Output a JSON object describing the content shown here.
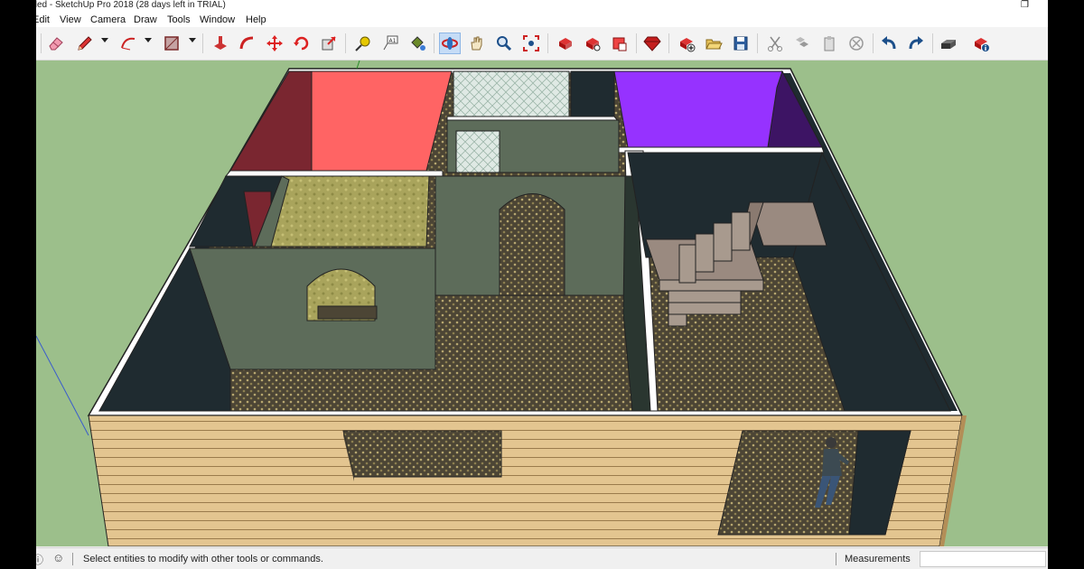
{
  "window": {
    "title": "tled - SketchUp Pro 2018 (28 days left in TRIAL)"
  },
  "menu": [
    "Edit",
    "View",
    "Camera",
    "Draw",
    "Tools",
    "Window",
    "Help"
  ],
  "toolbar": {
    "groups": [
      [
        "eraser-icon",
        "pencil-icon",
        "arc-icon",
        "rectangle-icon"
      ],
      [
        "push-pull-icon",
        "follow-me-icon",
        "move-icon",
        "rotate-icon",
        "scale-icon"
      ],
      [
        "tape-measure-icon",
        "text-icon",
        "paint-bucket-icon"
      ],
      [
        "orbit-icon",
        "pan-icon",
        "zoom-icon",
        "zoom-extents-icon"
      ],
      [
        "warehouse-icon",
        "share-model-icon",
        "extension-warehouse-icon"
      ],
      [
        "ruby-icon"
      ],
      [
        "new-icon",
        "open-icon",
        "save-icon"
      ],
      [
        "cut-icon",
        "copy-icon",
        "paste-icon",
        "erase-icon"
      ],
      [
        "undo-icon",
        "redo-icon"
      ],
      [
        "print-icon",
        "model-info-icon"
      ]
    ],
    "active_tool": "orbit-icon"
  },
  "status": {
    "hint": "Select entities to modify with other tools or commands.",
    "measurements_label": "Measurements",
    "measurements_value": ""
  },
  "colors": {
    "sky_ground": "#9cbf8b",
    "siding": "#e3c590",
    "room_red": "#ff6464",
    "room_purple": "#9632ff",
    "wall_green": "#5d6c5a",
    "wall_dark": "#1f2b30"
  }
}
